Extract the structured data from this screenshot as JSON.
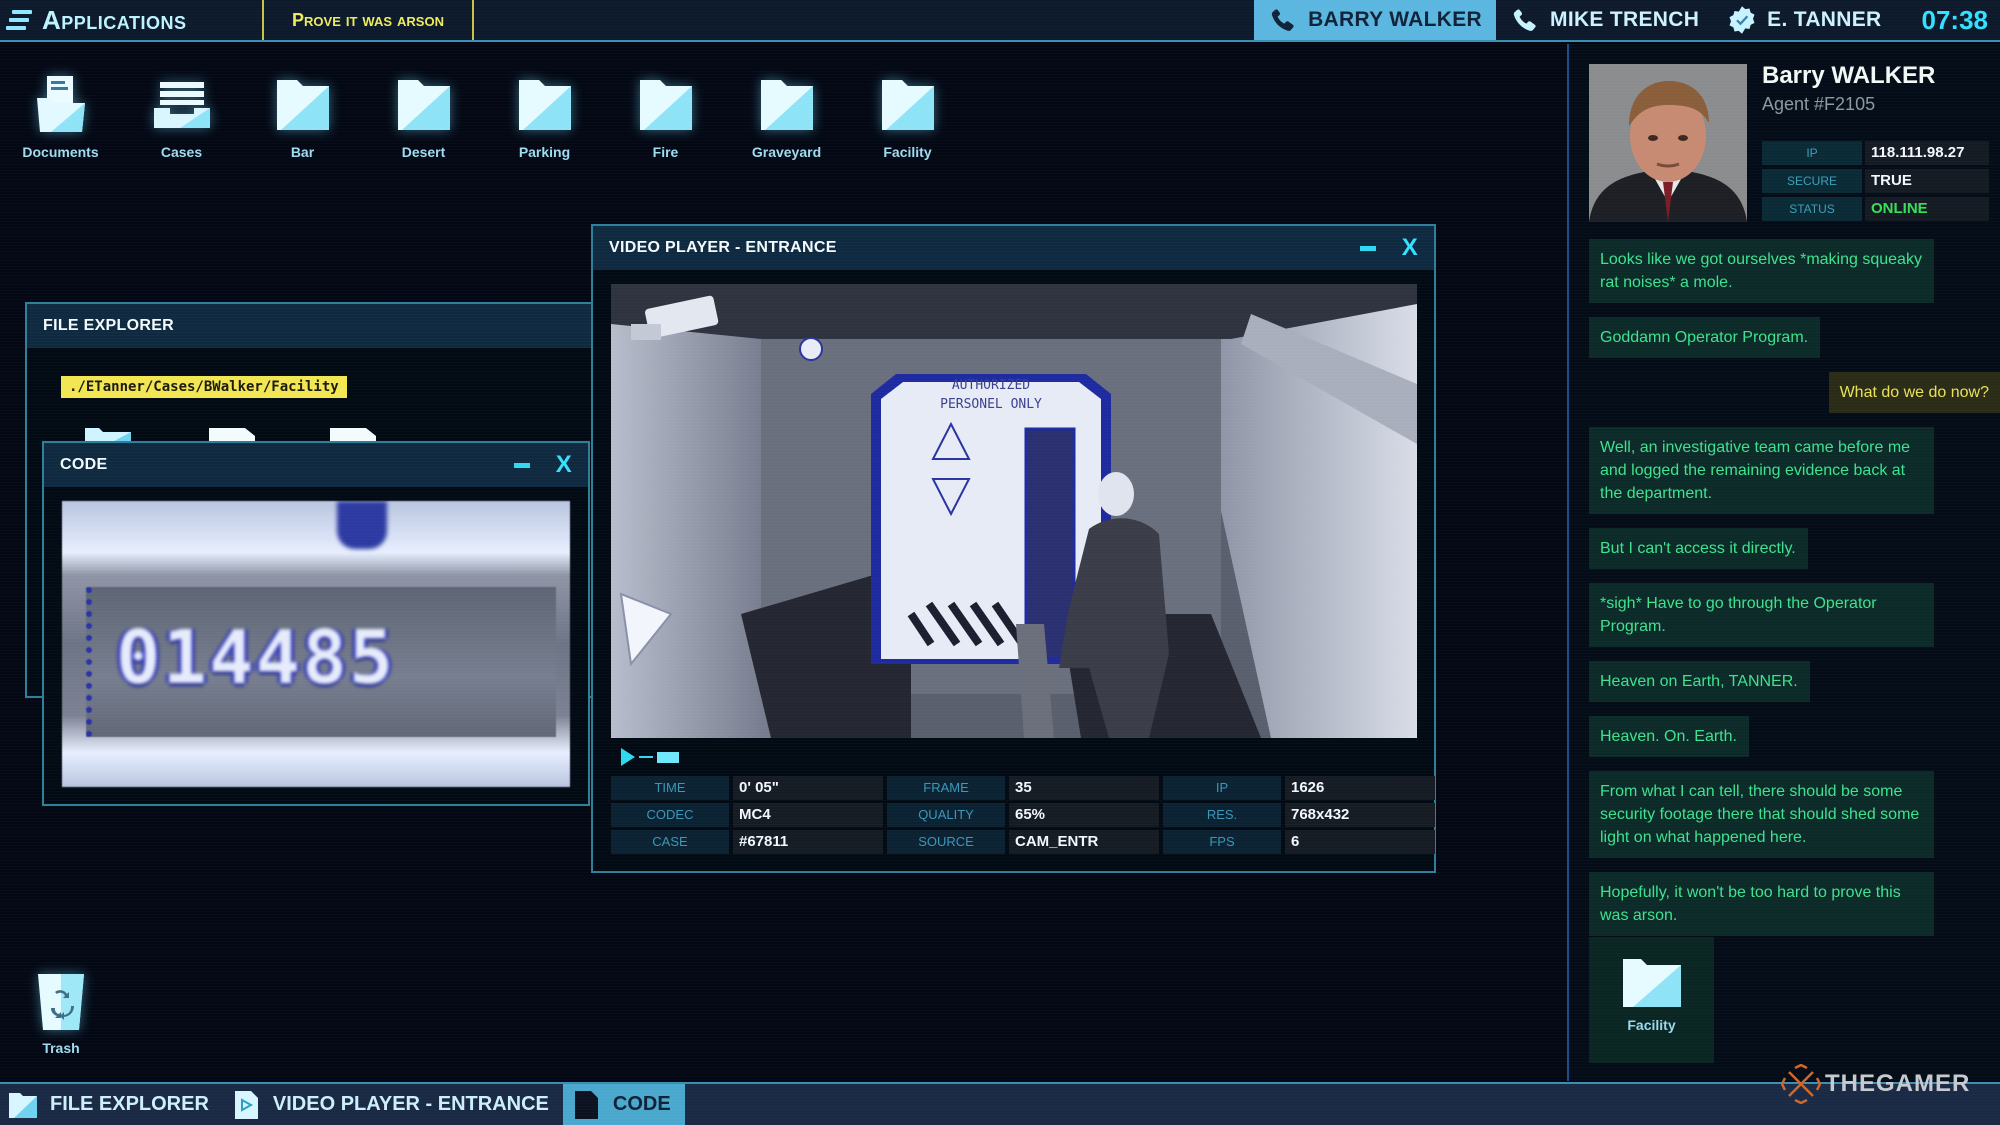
{
  "topbar": {
    "apps_label": "Applications",
    "mission": "Prove it was arson",
    "contacts": [
      {
        "name": "BARRY WALKER",
        "icon": "phone-icon",
        "active": true
      },
      {
        "name": "MIKE TRENCH",
        "icon": "phone-icon",
        "active": false
      },
      {
        "name": "E. TANNER",
        "icon": "verified-badge-icon",
        "active": false
      }
    ],
    "clock": "07:38"
  },
  "desktop": {
    "icons": [
      {
        "label": "Documents",
        "icon": "documents-folder-icon"
      },
      {
        "label": "Cases",
        "icon": "cases-drawer-icon"
      },
      {
        "label": "Bar",
        "icon": "folder-icon"
      },
      {
        "label": "Desert",
        "icon": "folder-icon"
      },
      {
        "label": "Parking",
        "icon": "folder-icon"
      },
      {
        "label": "Fire",
        "icon": "folder-icon"
      },
      {
        "label": "Graveyard",
        "icon": "folder-icon"
      },
      {
        "label": "Facility",
        "icon": "folder-icon"
      }
    ],
    "trash_label": "Trash"
  },
  "file_explorer": {
    "title": "FILE EXPLORER",
    "path": "./ETanner/Cases/BWalker/Facility"
  },
  "code_window": {
    "title": "CODE",
    "code_value": "014485"
  },
  "video_player": {
    "title": "VIDEO PLAYER - ENTRANCE",
    "sign_text": "AUTHORIZED PERSONEL ONLY",
    "progress": 0.15,
    "meta": [
      {
        "label": "TIME",
        "value": "0' 05\""
      },
      {
        "label": "FRAME",
        "value": "35"
      },
      {
        "label": "IP",
        "value": "1626"
      },
      {
        "label": "CODEC",
        "value": "MC4"
      },
      {
        "label": "QUALITY",
        "value": "65%"
      },
      {
        "label": "RES.",
        "value": "768x432"
      },
      {
        "label": "CASE",
        "value": "#67811"
      },
      {
        "label": "SOURCE",
        "value": "CAM_ENTR"
      },
      {
        "label": "FPS",
        "value": "6"
      }
    ]
  },
  "profile": {
    "name": "Barry WALKER",
    "agent_id": "Agent #F2105",
    "stats": [
      {
        "label": "IP",
        "value": "118.111.98.27"
      },
      {
        "label": "SECURE",
        "value": "TRUE"
      },
      {
        "label": "STATUS",
        "value": "ONLINE"
      }
    ]
  },
  "chat": {
    "messages": [
      {
        "from": "contact",
        "text": "Looks like we got ourselves *making squeaky rat noises* a mole."
      },
      {
        "from": "contact",
        "text": "Goddamn Operator Program."
      },
      {
        "from": "me",
        "text": "What do we do now?"
      },
      {
        "from": "contact",
        "text": "Well, an investigative team came before me and logged the remaining evidence back at the department."
      },
      {
        "from": "contact",
        "text": "But I can't access it directly."
      },
      {
        "from": "contact",
        "text": "*sigh* Have to go through the Operator Program."
      },
      {
        "from": "contact",
        "text": "Heaven on Earth, TANNER."
      },
      {
        "from": "contact",
        "text": "Heaven. On. Earth."
      },
      {
        "from": "contact",
        "text": "From what I can tell, there should be some security footage there that should shed some light on what happened here."
      },
      {
        "from": "contact",
        "text": "Hopefully, it won't be too hard to prove this was arson."
      }
    ],
    "shared_file_label": "Facility"
  },
  "taskbar": {
    "items": [
      {
        "label": "FILE EXPLORER",
        "icon": "folder-icon",
        "active": false
      },
      {
        "label": "VIDEO PLAYER - ENTRANCE",
        "icon": "video-file-icon",
        "active": false
      },
      {
        "label": "CODE",
        "icon": "file-icon",
        "active": true
      }
    ]
  },
  "watermark": "THEGAMER",
  "colors": {
    "accent_cyan": "#31e1ff",
    "mission_yellow": "#ecec5c",
    "chat_green": "#3ee28e",
    "online_green": "#36e05a",
    "active_tab": "#5bb6e0"
  }
}
